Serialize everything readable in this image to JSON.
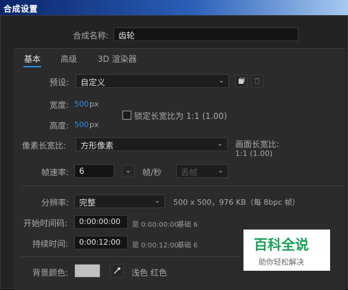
{
  "window": {
    "title": "合成设置"
  },
  "composition": {
    "name_label": "合成名称:",
    "name_value": "齿轮"
  },
  "tabs": [
    {
      "label": "基本",
      "active": true
    },
    {
      "label": "高级",
      "active": false
    },
    {
      "label": "3D 渲染器",
      "active": false
    }
  ],
  "preset": {
    "label": "预设:",
    "value": "自定义"
  },
  "width": {
    "label": "宽度:",
    "value": "500",
    "unit": "px"
  },
  "height": {
    "label": "高度:",
    "value": "500",
    "unit": "px"
  },
  "lock_aspect": {
    "label": "锁定长宽比为 1:1 (1.00)",
    "checked": false
  },
  "pixel_aspect": {
    "label": "像素长宽比:",
    "value": "方形像素"
  },
  "frame_aspect": {
    "label": "画面长宽比:",
    "value": "1:1 (1.00)"
  },
  "frame_rate": {
    "label": "帧速率:",
    "value": "6",
    "unit": "帧/秒",
    "dropframe": "丢帧"
  },
  "resolution": {
    "label": "分辨率:",
    "value": "完整",
    "info": "500 x 500，976 KB（每 8bpc 帧）"
  },
  "start_timecode": {
    "label": "开始时间码:",
    "value": "0:00:00:00",
    "info": "是 0:00:00:00",
    "base": "基础 6"
  },
  "duration": {
    "label": "持续时间:",
    "value": "0:00:12:00",
    "info": "是 0:00:12:00",
    "base": "基础 6"
  },
  "background": {
    "label": "背景颜色:",
    "color_name": "浅色 红色",
    "swatch": "#c1c1c1"
  },
  "watermark": {
    "title": "百科全说",
    "subtitle": "助你轻松解决"
  },
  "icons": [
    "preset-save-icon",
    "trash-icon",
    "eyedropper-icon",
    "chevron-down-icon"
  ]
}
